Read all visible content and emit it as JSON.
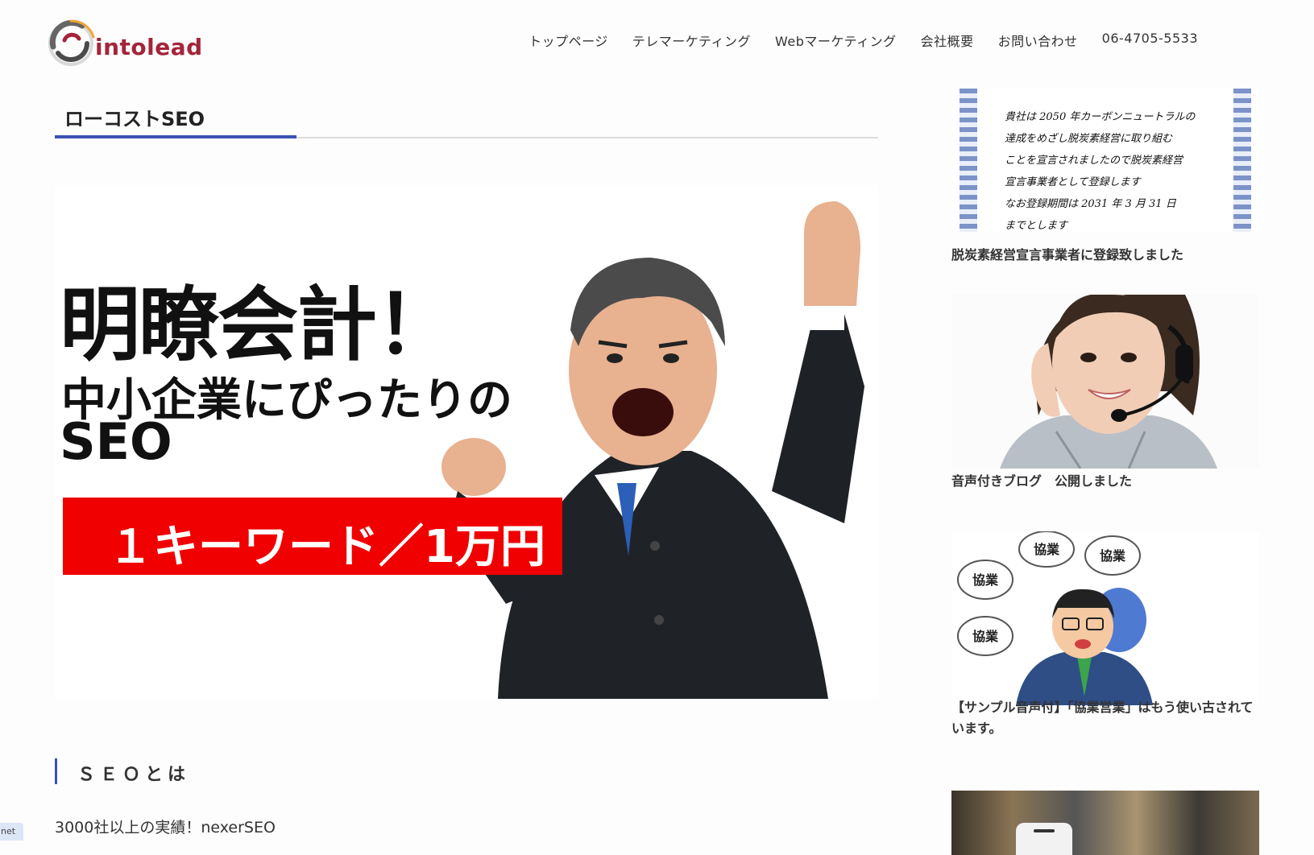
{
  "header": {
    "logo_text": "intolead",
    "nav": [
      {
        "label": "トップページ"
      },
      {
        "label": "テレマーケティング"
      },
      {
        "label": "Webマーケティング"
      },
      {
        "label": "会社概要"
      },
      {
        "label": "お問い合わせ"
      },
      {
        "label": "06-4705-5533"
      }
    ]
  },
  "main": {
    "page_title": "ローコストSEO",
    "hero": {
      "line1": "明瞭会計！",
      "line2": "中小企業にぴったりの",
      "line3": "SEO",
      "band": "１キーワード／1万円"
    },
    "section_heading": "ＳＥＯとは",
    "body_text": "3000社以上の実績！nexerSEO"
  },
  "sidebar": {
    "certificate_text": "貴社は 2050 年カーボンニュートラルの\n達成をめざし脱炭素経営に取り組む\nことを宣言されましたので脱炭素経営\n宣言事業者として登録します\nなお登録期間は 2031 年 3 月 31 日\nまでとします",
    "items": [
      {
        "caption": "脱炭素経営宣言事業者に登録致しました"
      },
      {
        "caption": "音声付きブログ　公開しました"
      },
      {
        "caption": "【サンプル音声付】「協業営業」はもう使い古されています。"
      }
    ],
    "bubble_text": "協業"
  },
  "status_tag": "net",
  "colors": {
    "accent": "#3b52b4",
    "brand": "#a4243b",
    "band_red": "#f00000"
  }
}
